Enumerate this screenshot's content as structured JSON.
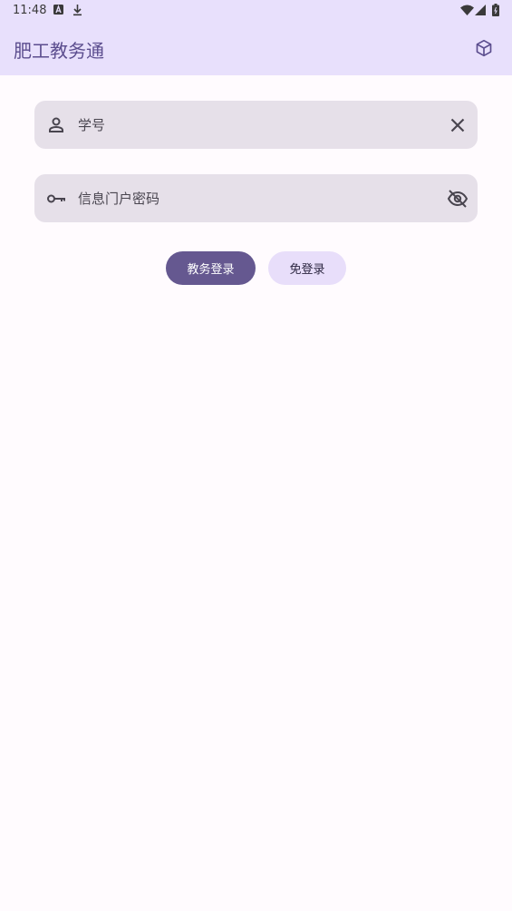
{
  "status_bar": {
    "time": "11:48",
    "notification_icons": [
      "font-a-icon",
      "download-icon"
    ],
    "system_icons": [
      "wifi-icon",
      "signal-icon",
      "battery-icon"
    ]
  },
  "app_bar": {
    "title": "肥工教务通",
    "action_icon": "cube-icon"
  },
  "login_form": {
    "student_id": {
      "value": "",
      "placeholder": "学号",
      "leading_icon": "person-icon",
      "trailing_icon": "clear-icon"
    },
    "password": {
      "value": "",
      "placeholder": "信息门户密码",
      "leading_icon": "key-icon",
      "trailing_icon": "visibility-off-icon"
    },
    "primary_button": "教务登录",
    "secondary_button": "免登录"
  },
  "colors": {
    "app_bar_bg": "#e8e0fc",
    "page_bg": "#fffbfe",
    "field_bg": "#e6e0e9",
    "primary": "#655890",
    "secondary_container": "#e8defa"
  }
}
